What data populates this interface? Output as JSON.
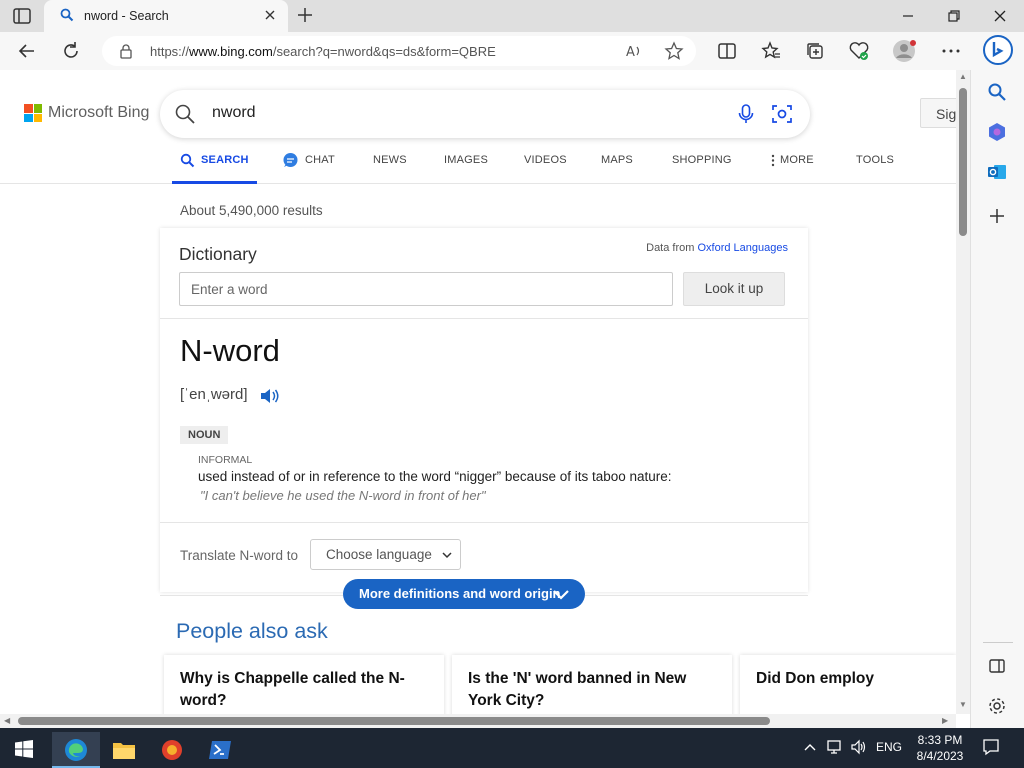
{
  "browser": {
    "tab_title": "nword - Search",
    "url_prefix": "https://",
    "url_host": "www.bing.com",
    "url_rest": "/search?q=nword&qs=ds&form=QBRE"
  },
  "header": {
    "logo_text": "Microsoft Bing",
    "query": "nword",
    "signin_label": "Sig"
  },
  "scopes": [
    {
      "label": "SEARCH",
      "active": true
    },
    {
      "label": "CHAT"
    },
    {
      "label": "NEWS"
    },
    {
      "label": "IMAGES"
    },
    {
      "label": "VIDEOS"
    },
    {
      "label": "MAPS"
    },
    {
      "label": "SHOPPING"
    },
    {
      "label": "MORE"
    },
    {
      "label": "TOOLS"
    }
  ],
  "results_count": "About 5,490,000 results",
  "dictionary": {
    "heading": "Dictionary",
    "source_prefix": "Data from ",
    "source_link": "Oxford Languages",
    "input_placeholder": "Enter a word",
    "lookup_label": "Look it up",
    "word": "N-word",
    "pronunciation": "[ˈenˌwərd]",
    "part_of_speech": "NOUN",
    "register": "INFORMAL",
    "definition": "used instead of or in reference to the word “nigger” because of its taboo nature:",
    "example": "\"I can't believe he used the N-word in front of her\"",
    "translate_label": "Translate N-word to",
    "language_select": "Choose language",
    "more_label": "More definitions and word origin"
  },
  "people_also_ask": {
    "title": "People also ask",
    "questions": [
      "Why is Chappelle called the N-word?",
      "Is the 'N' word banned in New York City?",
      "Did Don employ"
    ]
  },
  "taskbar": {
    "language": "ENG",
    "time": "8:33 PM",
    "date": "8/4/2023"
  },
  "colors": {
    "bing_blue": "#174ae4",
    "paa_blue": "#2b6ab3",
    "button_blue": "#1a64c4"
  }
}
